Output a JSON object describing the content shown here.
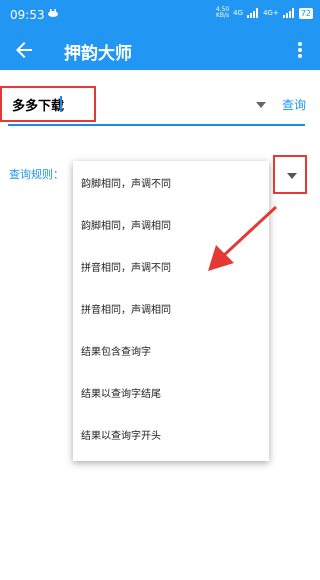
{
  "status_bar": {
    "time": "09:53",
    "net_speed": "4.50",
    "net_unit": "KB/s",
    "signal_1": "4G",
    "signal_2": "4G+",
    "battery": "72"
  },
  "app_bar": {
    "title": "押韵大师"
  },
  "search": {
    "value": "多多下载",
    "button_label": "查询"
  },
  "rule": {
    "label": "查询规则："
  },
  "rule_menu": {
    "options": [
      "韵脚相同，声调不同",
      "韵脚相同，声调相同",
      "拼音相同，声调不同",
      "拼音相同，声调相同",
      "结果包含查询字",
      "结果以查询字结尾",
      "结果以查询字开头"
    ]
  },
  "colors": {
    "primary": "#2196f3",
    "annotation": "#e53935"
  }
}
